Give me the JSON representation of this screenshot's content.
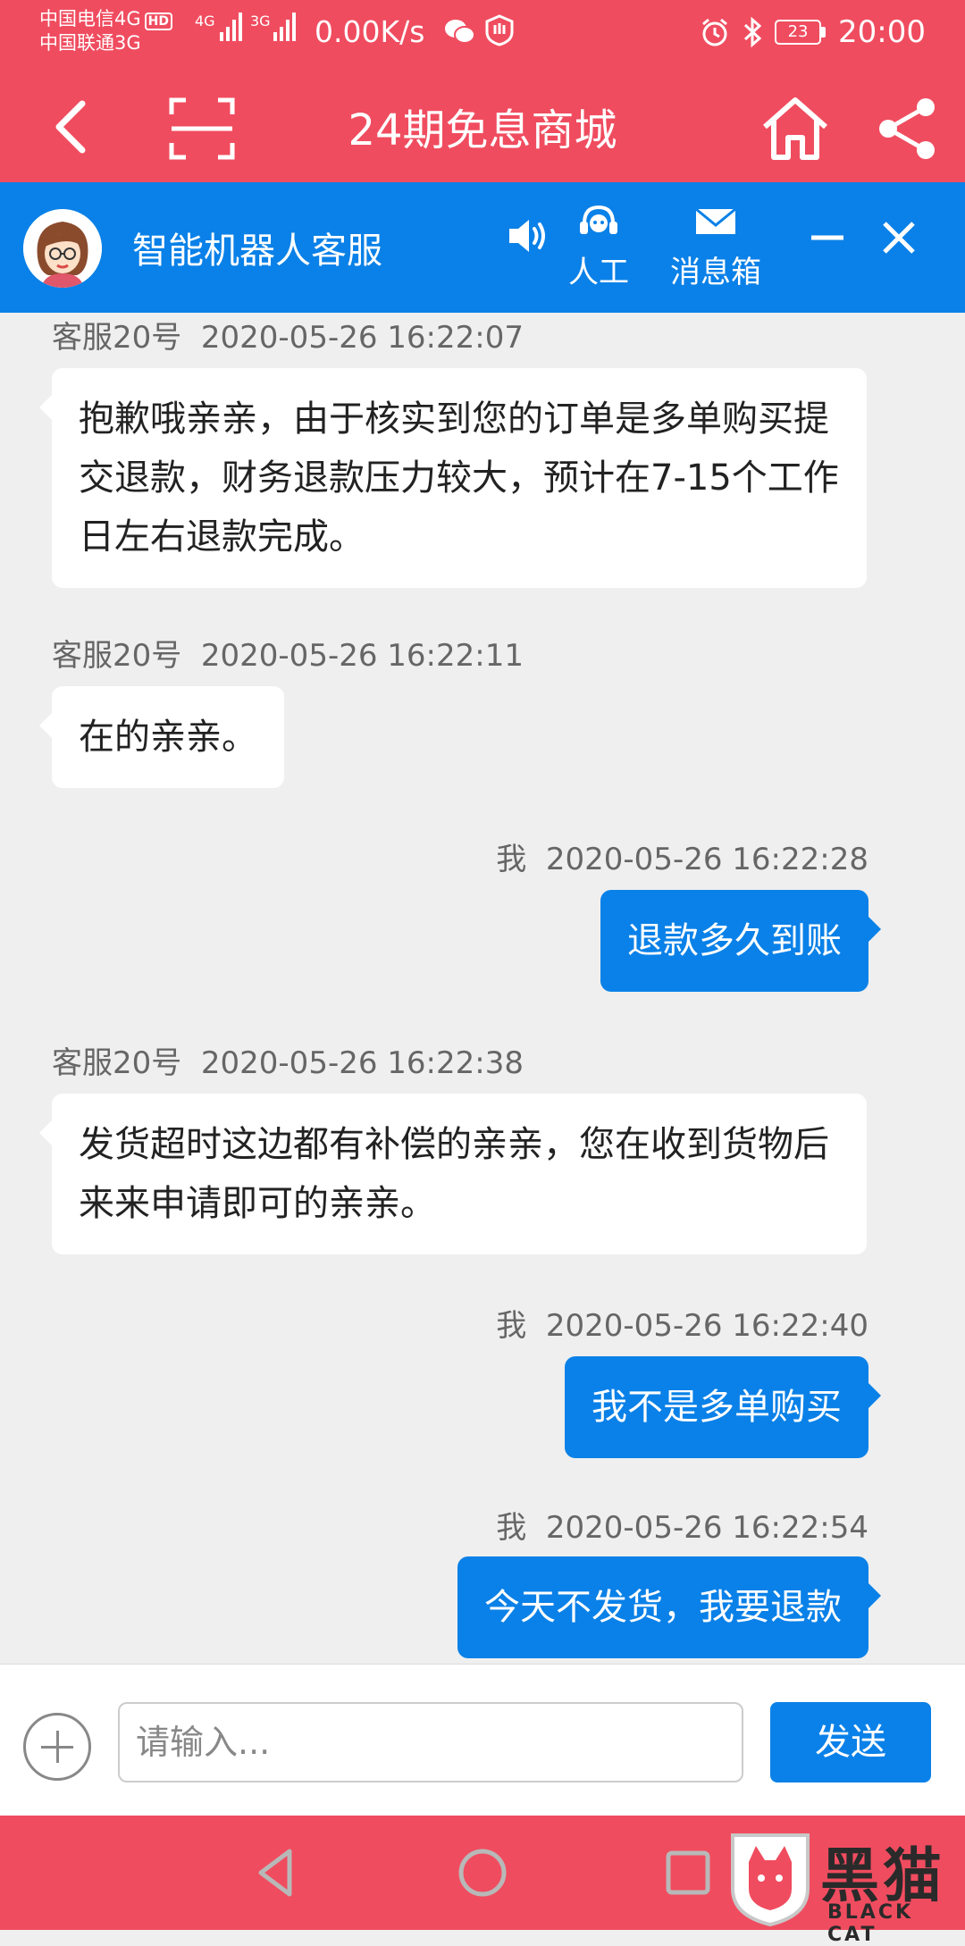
{
  "status_bar": {
    "carrier1": "中国电信4G",
    "hd": "HD",
    "carrier2": "中国联通3G",
    "net1": "4G",
    "net2": "3G",
    "speed": "0.00K/s",
    "battery": "23",
    "time": "20:00"
  },
  "nav": {
    "title": "24期免息商城"
  },
  "robot_bar": {
    "name": "智能机器人客服",
    "human_label": "人工",
    "inbox_label": "消息箱"
  },
  "messages": [
    {
      "sender": "客服20号",
      "time": "2020-05-26 16:22:07",
      "text": "抱歉哦亲亲，由于核实到您的订单是多单购买提交退款，财务退款压力较大，预计在7-15个工作日左右退款完成。"
    },
    {
      "sender": "客服20号",
      "time": "2020-05-26 16:22:11",
      "text": "在的亲亲。"
    },
    {
      "sender": "我",
      "time": "2020-05-26 16:22:28",
      "text": "退款多久到账"
    },
    {
      "sender": "客服20号",
      "time": "2020-05-26 16:22:38",
      "text": "发货超时这边都有补偿的亲亲，您在收到货物后来来申请即可的亲亲。"
    },
    {
      "sender": "我",
      "time": "2020-05-26 16:22:40",
      "text": "我不是多单购买"
    },
    {
      "sender": "我",
      "time": "2020-05-26 16:22:54",
      "text": "今天不发货，我要退款"
    }
  ],
  "input": {
    "placeholder": "请输入...",
    "send_label": "发送"
  },
  "watermark": {
    "text": "黑猫",
    "sub": "BLACK CAT"
  },
  "colors": {
    "header_red": "#f04c5f",
    "accent_blue": "#0a81e8"
  }
}
